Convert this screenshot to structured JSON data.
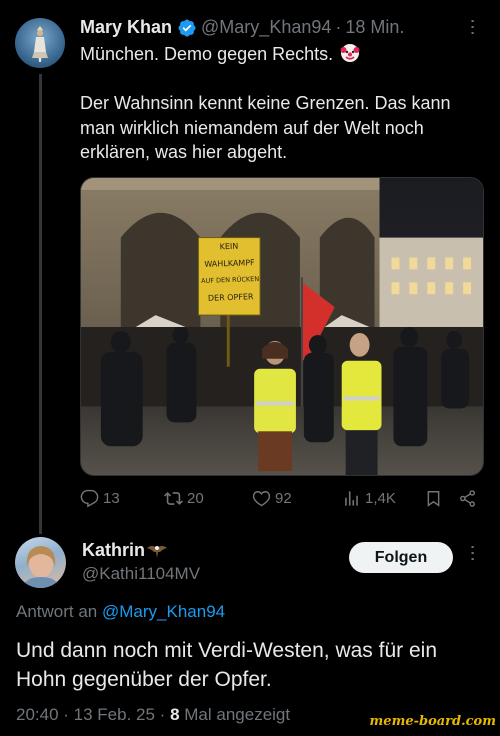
{
  "tweet": {
    "author_name": "Mary Khan",
    "handle": "@Mary_Khan94",
    "separator": "·",
    "time": "18 Min.",
    "text_line1": "München. Demo gegen Rechts.",
    "text_para2": "Der Wahnsinn kennt keine Grenzen. Das kann man wirklich niemandem auf der Welt noch erklären, was hier abgeht.",
    "sign_text": [
      "KEIN",
      "WAHLKAMPF",
      "AUF DEN RÜCKEN",
      "DER OPFER"
    ],
    "stats": {
      "replies": "13",
      "reposts": "20",
      "likes": "92",
      "views": "1,4K"
    },
    "icons": {
      "verified": "verified-badge-icon",
      "clown": "clown-emoji-icon",
      "reply": "reply-icon",
      "repost": "repost-icon",
      "like": "heart-icon",
      "views": "views-icon",
      "bookmark": "bookmark-icon",
      "share": "share-icon",
      "more": "more-icon"
    },
    "colors": {
      "verified": "#1d9bf0",
      "link": "#1d9bf0",
      "muted": "#71767b"
    }
  },
  "reply": {
    "author_name": "Kathrin",
    "handle": "@Kathi1104MV",
    "follow_label": "Folgen",
    "reply_to_prefix": "Antwort an",
    "reply_to_handle": "@Mary_Khan94",
    "text": "Und dann noch mit Verdi-Westen, was für ein Hohn gegenüber der Opfer.",
    "timestamp": "20:40 · 13 Feb. 25 ·",
    "views_count": "8",
    "views_label": "Mal angezeigt",
    "icons": {
      "name_emoji": "eagle-emoji-icon"
    }
  },
  "watermark": "meme-board.com"
}
